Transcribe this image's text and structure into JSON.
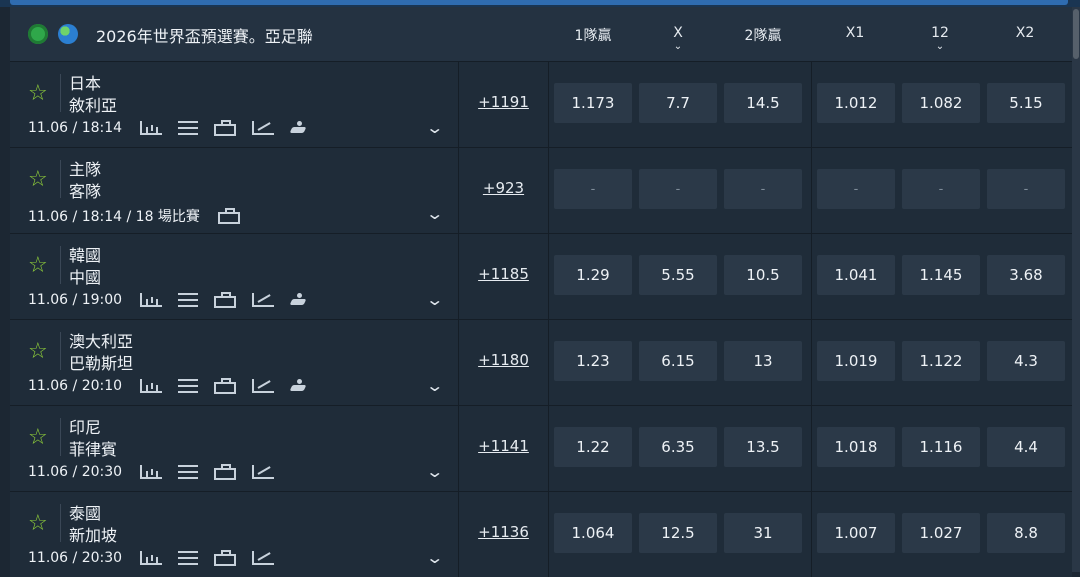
{
  "header": {
    "title": "2026年世界盃預選賽。亞足聯",
    "columns": [
      "1隊贏",
      "X",
      "2隊贏",
      "X1",
      "12",
      "X2"
    ]
  },
  "rows": [
    {
      "team1": "日本",
      "team2": "敘利亞",
      "meta": "11.06 / 18:14",
      "more": "+1191",
      "odds": [
        "1.173",
        "7.7",
        "14.5",
        "1.012",
        "1.082",
        "5.15"
      ],
      "tools": [
        "bars",
        "list",
        "field",
        "trend",
        "player"
      ]
    },
    {
      "team1": "主隊",
      "team2": "客隊",
      "meta": "11.06 / 18:14 / 18 場比賽",
      "more": "+923",
      "odds": [
        "-",
        "-",
        "-",
        "-",
        "-",
        "-"
      ],
      "tools": [
        "field"
      ]
    },
    {
      "team1": "韓國",
      "team2": "中國",
      "meta": "11.06 / 19:00",
      "more": "+1185",
      "odds": [
        "1.29",
        "5.55",
        "10.5",
        "1.041",
        "1.145",
        "3.68"
      ],
      "tools": [
        "bars",
        "list",
        "field",
        "trend",
        "player"
      ]
    },
    {
      "team1": "澳大利亞",
      "team2": "巴勒斯坦",
      "meta": "11.06 / 20:10",
      "more": "+1180",
      "odds": [
        "1.23",
        "6.15",
        "13",
        "1.019",
        "1.122",
        "4.3"
      ],
      "tools": [
        "bars",
        "list",
        "field",
        "trend",
        "player"
      ]
    },
    {
      "team1": "印尼",
      "team2": "菲律賓",
      "meta": "11.06 / 20:30",
      "more": "+1141",
      "odds": [
        "1.22",
        "6.35",
        "13.5",
        "1.018",
        "1.116",
        "4.4"
      ],
      "tools": [
        "bars",
        "list",
        "field",
        "trend"
      ]
    },
    {
      "team1": "泰國",
      "team2": "新加坡",
      "meta": "11.06 / 20:30",
      "more": "+1136",
      "odds": [
        "1.064",
        "12.5",
        "31",
        "1.007",
        "1.027",
        "8.8"
      ],
      "tools": [
        "bars",
        "list",
        "field",
        "trend"
      ]
    }
  ],
  "icons": {
    "star": "star-icon",
    "expand": "chevron-down-icon"
  }
}
